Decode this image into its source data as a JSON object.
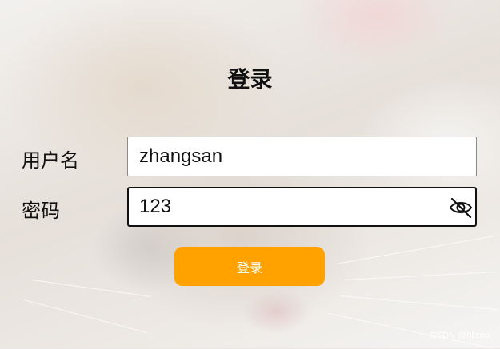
{
  "form": {
    "title": "登录",
    "username": {
      "label": "用户名",
      "value": "zhangsan"
    },
    "password": {
      "label": "密码",
      "value": "123",
      "toggle_icon": "eye-off-icon"
    },
    "submit_label": "登录"
  },
  "watermark": "CSDN @hlizoo",
  "colors": {
    "button": "#ffa200",
    "button_text": "#ffffff",
    "text": "#111111"
  }
}
